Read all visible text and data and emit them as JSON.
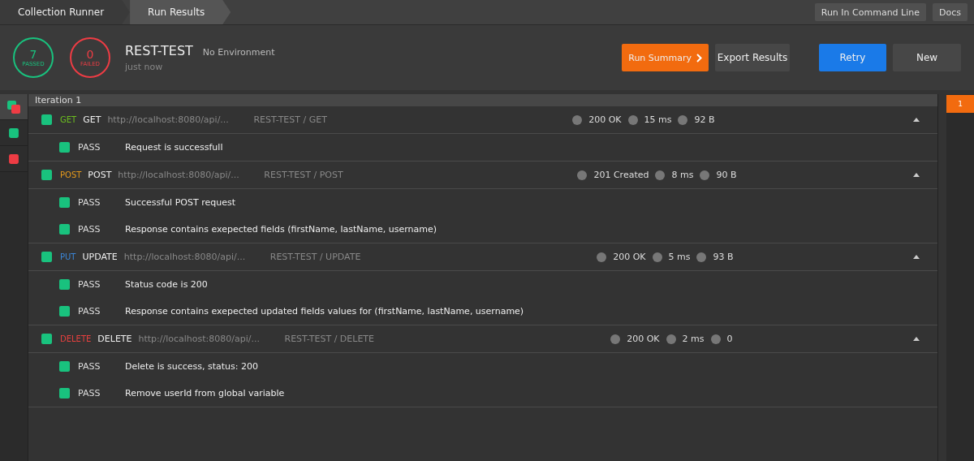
{
  "breadcrumbs": [
    {
      "label": "Collection Runner",
      "selected": false
    },
    {
      "label": "Run Results",
      "selected": true
    }
  ],
  "top_buttons": [
    "Run In Command Line",
    "Docs"
  ],
  "summary": {
    "passed": {
      "count": "7",
      "label": "PASSED"
    },
    "failed": {
      "count": "0",
      "label": "FAILED"
    },
    "name": "REST-TEST",
    "environment": "No Environment",
    "time": "just now"
  },
  "actions": [
    {
      "label": "Run Summary",
      "kind": "primary"
    },
    {
      "label": "Export Results",
      "kind": "plain"
    },
    {
      "label": "Retry",
      "kind": "accent"
    },
    {
      "label": "New",
      "kind": "plain"
    }
  ],
  "filters": [
    {
      "kind": "all",
      "selected": true
    },
    {
      "kind": "passed",
      "selected": false
    },
    {
      "kind": "failed",
      "selected": false
    }
  ],
  "iteration": {
    "title": "Iteration 1"
  },
  "requests": [
    {
      "method": "GET",
      "color": "#6cbf1f",
      "name": "GET",
      "url": "http://localhost:8080/api/...",
      "path": "REST-TEST / GET",
      "status": "200 OK",
      "time": "15 ms",
      "size": "92 B",
      "expanded": true,
      "tests": [
        {
          "result": "PASS",
          "name": "Request is successfull"
        }
      ]
    },
    {
      "method": "POST",
      "color": "#e59a1c",
      "name": "POST",
      "url": "http://localhost:8080/api/...",
      "path": "REST-TEST / POST",
      "status": "201 Created",
      "time": "8 ms",
      "size": "90 B",
      "expanded": true,
      "tests": [
        {
          "result": "PASS",
          "name": "Successful POST request"
        },
        {
          "result": "PASS",
          "name": "Response contains exepected fields (firstName, lastName, username)"
        }
      ]
    },
    {
      "method": "PUT",
      "color": "#3b86d8",
      "name": "UPDATE",
      "url": "http://localhost:8080/api/...",
      "path": "REST-TEST / UPDATE",
      "status": "200 OK",
      "time": "5 ms",
      "size": "93 B",
      "expanded": true,
      "tests": [
        {
          "result": "PASS",
          "name": "Status code is 200"
        },
        {
          "result": "PASS",
          "name": "Response contains exepected updated fields values for (firstName, lastName, username)"
        }
      ]
    },
    {
      "method": "DELETE",
      "color": "#e8403e",
      "name": "DELETE",
      "url": "http://localhost:8080/api/...",
      "path": "REST-TEST / DELETE",
      "status": "200 OK",
      "time": "2 ms",
      "size": "0",
      "expanded": true,
      "tests": [
        {
          "result": "PASS",
          "name": "Delete is success, status: 200"
        },
        {
          "result": "PASS",
          "name": "Remove userId from global variable"
        }
      ]
    }
  ],
  "iterations": [
    {
      "label": "1",
      "selected": true
    }
  ]
}
